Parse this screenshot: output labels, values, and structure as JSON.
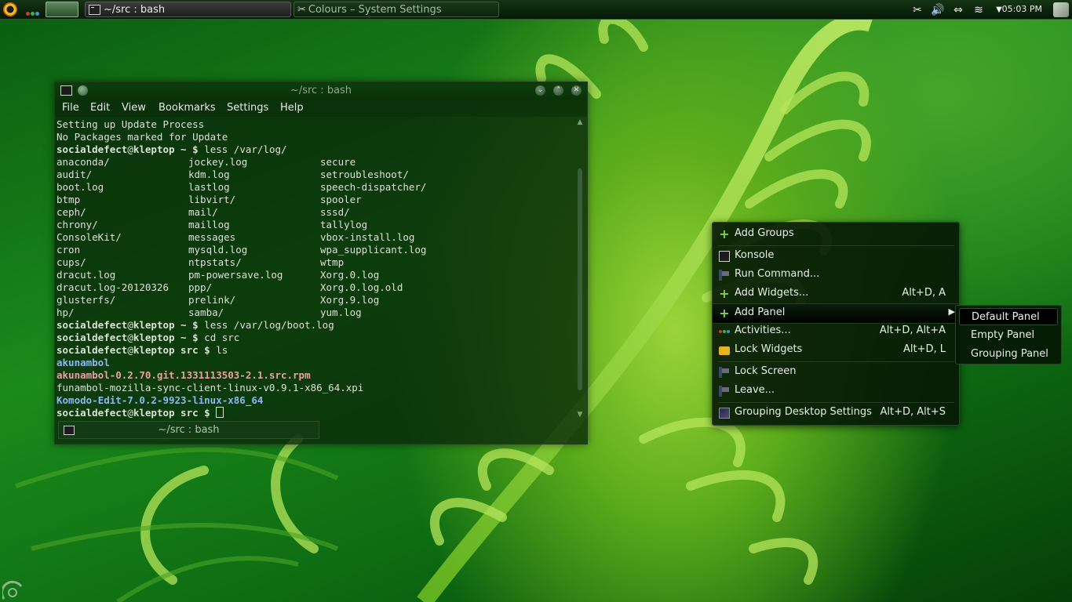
{
  "colors": {
    "accent": "#7fd14a",
    "desktop_green": "#1b8a1c",
    "prompt_blue": "#8cb8f0",
    "archive_red": "#e9a0a0"
  },
  "top_panel": {
    "launcher_icon": "kde-launcher-icon",
    "tasks": [
      {
        "title": "~/src : bash",
        "icon": "terminal-icon",
        "active": true
      },
      {
        "title": "Colours – System Settings",
        "icon": "tools-icon",
        "active": false
      }
    ],
    "tray_icons": [
      "scissors-icon",
      "volume-icon",
      "usb-icon",
      "wifi-icon",
      "expand-tray-icon"
    ],
    "clock": "05:03 PM"
  },
  "konsole": {
    "title": "~/src : bash",
    "menu": [
      "File",
      "Edit",
      "View",
      "Bookmarks",
      "Settings",
      "Help"
    ],
    "tab_label": "~/src : bash",
    "lines_top": [
      {
        "text": "Setting up Update Process"
      },
      {
        "text": "No Packages marked for Update"
      }
    ],
    "prompt1": {
      "user": "socialdefect",
      "at": "@",
      "host": "kleptop",
      "dir": " ~ $ ",
      "cmd": "less /var/log/"
    },
    "listing": [
      [
        "anaconda/",
        "jockey.log",
        "secure"
      ],
      [
        "audit/",
        "kdm.log",
        "setroubleshoot/"
      ],
      [
        "boot.log",
        "lastlog",
        "speech-dispatcher/"
      ],
      [
        "btmp",
        "libvirt/",
        "spooler"
      ],
      [
        "ceph/",
        "mail/",
        "sssd/"
      ],
      [
        "chrony/",
        "maillog",
        "tallylog"
      ],
      [
        "ConsoleKit/",
        "messages",
        "vbox-install.log"
      ],
      [
        "cron",
        "mysqld.log",
        "wpa_supplicant.log"
      ],
      [
        "cups/",
        "ntpstats/",
        "wtmp"
      ],
      [
        "dracut.log",
        "pm-powersave.log",
        "Xorg.0.log"
      ],
      [
        "dracut.log-20120326",
        "ppp/",
        "Xorg.0.log.old"
      ],
      [
        "glusterfs/",
        "prelink/",
        "Xorg.9.log"
      ],
      [
        "hp/",
        "samba/",
        "yum.log"
      ]
    ],
    "prompt2": {
      "user": "socialdefect",
      "at": "@",
      "host": "kleptop",
      "dir": " ~ $ ",
      "cmd": "less /var/log/boot.log"
    },
    "prompt3": {
      "user": "socialdefect",
      "at": "@",
      "host": "kleptop",
      "dir": " ~ $ ",
      "cmd": "cd src"
    },
    "prompt4": {
      "user": "socialdefect",
      "at": "@",
      "host": "kleptop",
      "dir": " src $ ",
      "cmd": "ls"
    },
    "src_files": [
      "akunambol",
      "akunambol-0.2.70.git.1331113503-2.1.src.rpm",
      "funambol-mozilla-sync-client-linux-v0.9.1-x86_64.xpi",
      "Komodo-Edit-7.0.2-9923-linux-x86_64"
    ],
    "prompt5": {
      "user": "socialdefect",
      "at": "@",
      "host": "kleptop",
      "dir": " src $ ",
      "cmd": ""
    }
  },
  "context_menu": {
    "items": [
      {
        "label": "Add Groups",
        "shortcut": "",
        "icon": "add-icon"
      },
      {
        "label": "Konsole",
        "shortcut": "",
        "icon": "terminal-icon"
      },
      {
        "label": "Run Command...",
        "shortcut": "",
        "icon": "run-command-icon"
      },
      {
        "label": "Add Widgets...",
        "shortcut": "Alt+D, A",
        "icon": "add-icon"
      },
      {
        "label": "Add Panel",
        "shortcut": "",
        "icon": "add-icon",
        "has_submenu": true
      },
      {
        "label": "Activities...",
        "shortcut": "Alt+D, Alt+A",
        "icon": "activities-icon"
      },
      {
        "label": "Lock Widgets",
        "shortcut": "Alt+D, L",
        "icon": "lock-icon"
      },
      {
        "label": "Lock Screen",
        "shortcut": "",
        "icon": "lock-screen-icon"
      },
      {
        "label": "Leave...",
        "shortcut": "",
        "icon": "leave-icon"
      },
      {
        "label": "Grouping Desktop Settings",
        "shortcut": "Alt+D, Alt+S",
        "icon": "settings-icon"
      }
    ],
    "submenu": [
      "Default Panel",
      "Empty Panel",
      "Grouping Panel"
    ]
  }
}
